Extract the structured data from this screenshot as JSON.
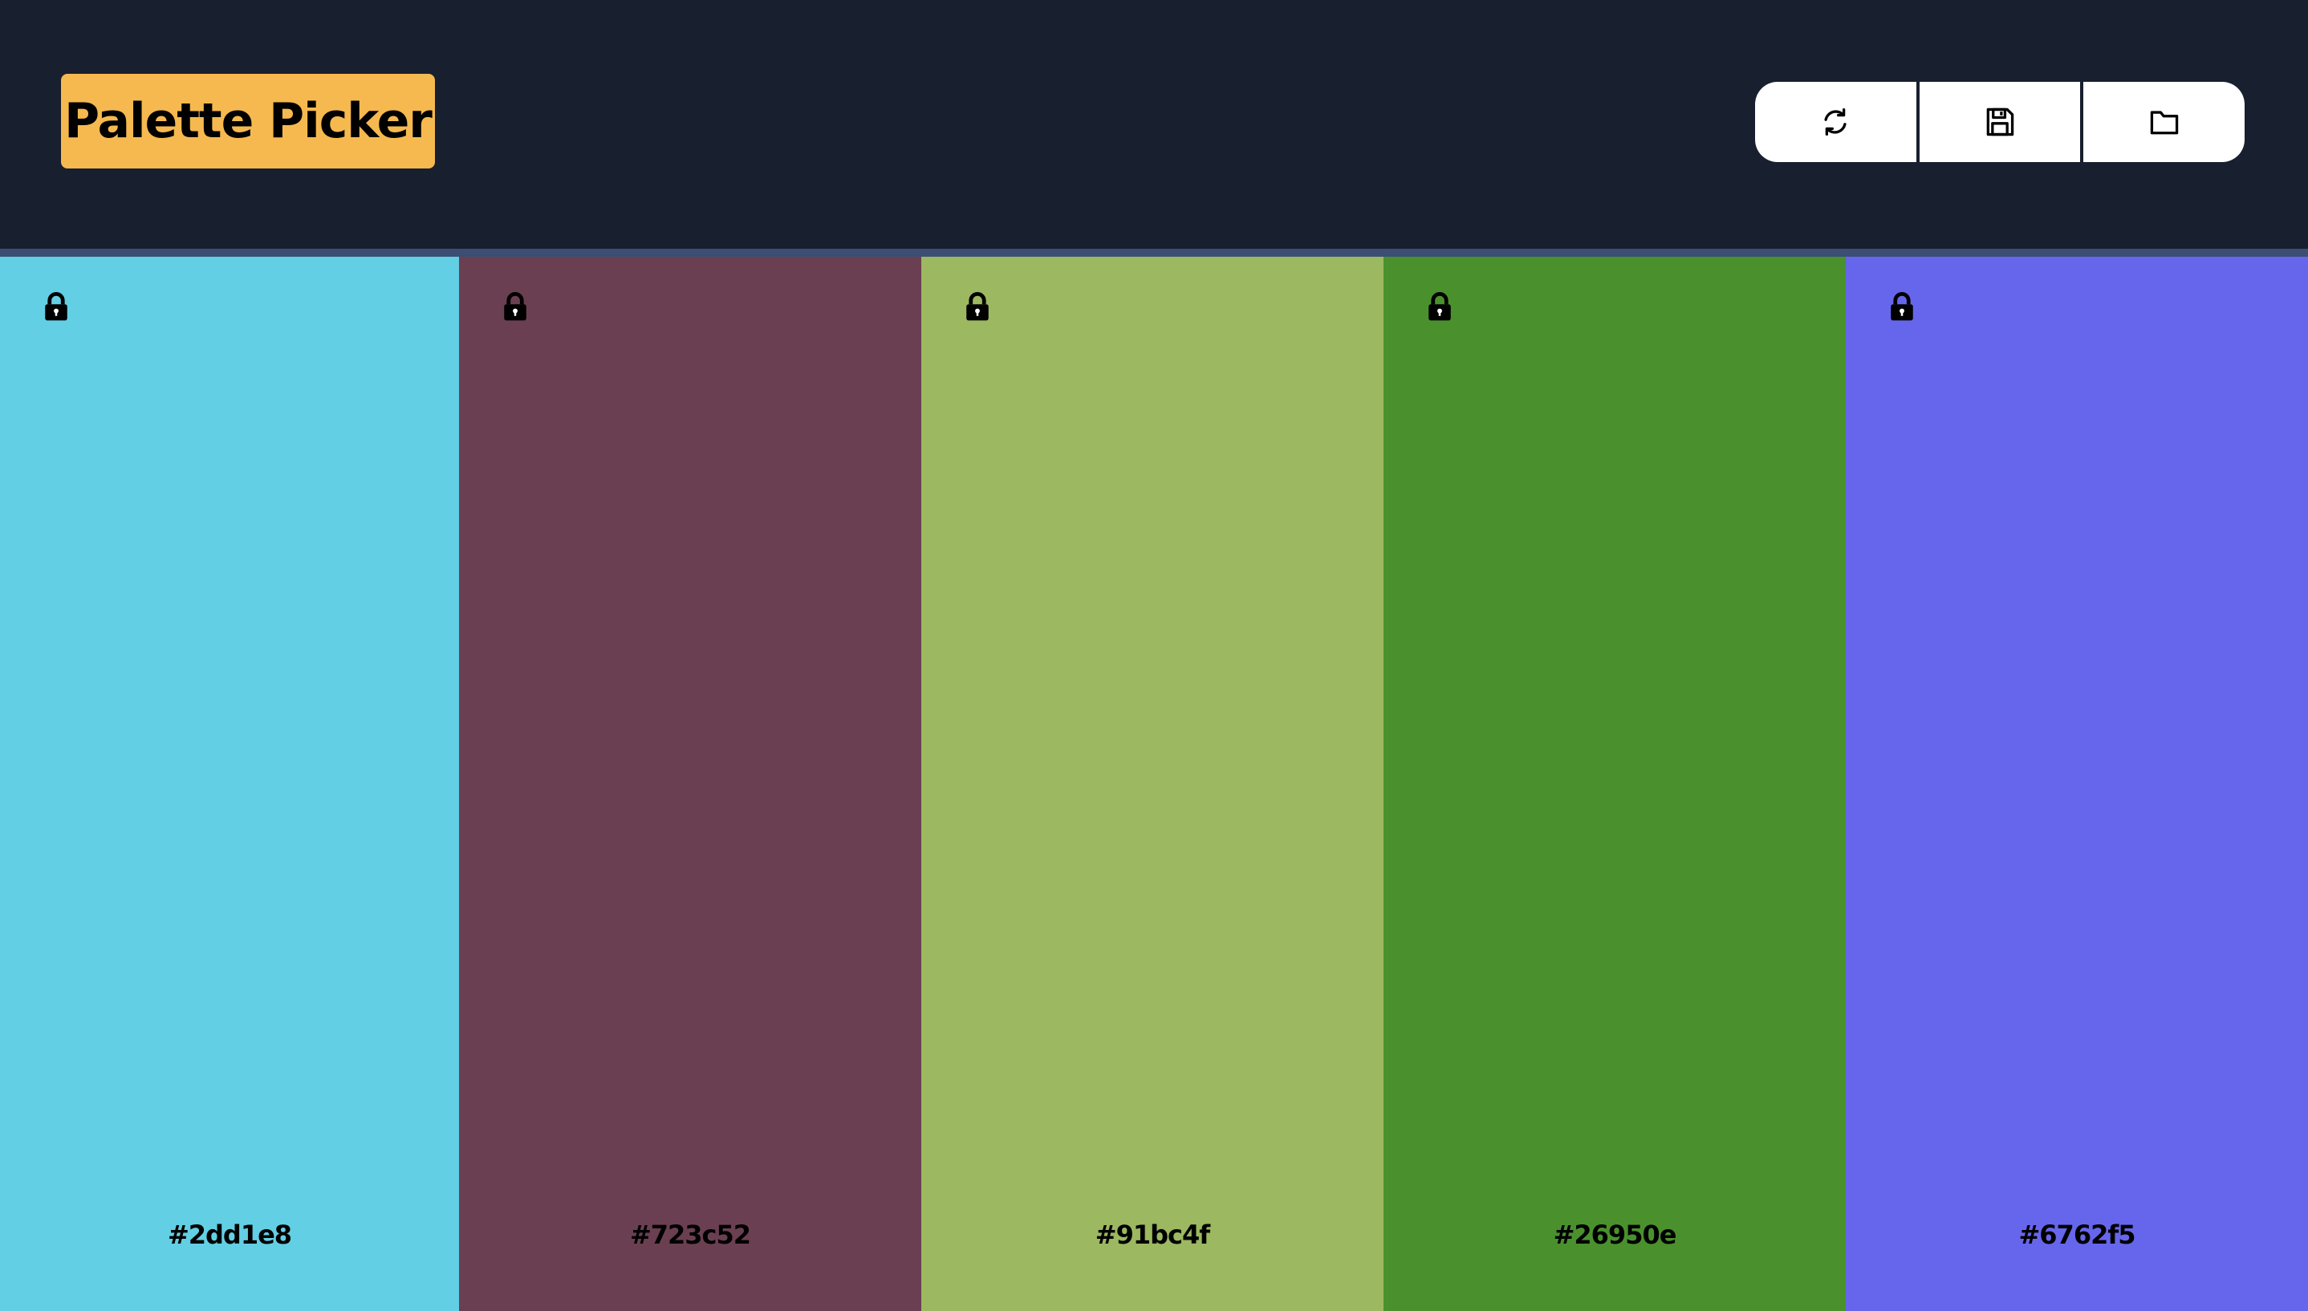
{
  "app": {
    "title": "Palette Picker",
    "accent_color": "#f5b94f",
    "header_color": "#181f2e"
  },
  "toolbar": {
    "buttons": [
      {
        "name": "refresh-button",
        "icon": "refresh-icon"
      },
      {
        "name": "save-button",
        "icon": "floppy-disk-icon"
      },
      {
        "name": "open-folder-button",
        "icon": "folder-icon"
      }
    ]
  },
  "palette": {
    "swatches": [
      {
        "hex_label": "#2dd1e8",
        "display_color": "#62cfe4",
        "lock_icon": "lock-icon",
        "locked": true
      },
      {
        "hex_label": "#723c52",
        "display_color": "#6b3f52",
        "lock_icon": "lock-icon",
        "locked": true
      },
      {
        "hex_label": "#91bc4f",
        "display_color": "#9cb860",
        "lock_icon": "lock-icon",
        "locked": true
      },
      {
        "hex_label": "#26950e",
        "display_color": "#4a912e",
        "lock_icon": "lock-icon",
        "locked": true
      },
      {
        "hex_label": "#6762f5",
        "display_color": "#6666ec",
        "lock_icon": "lock-icon",
        "locked": true
      }
    ]
  }
}
